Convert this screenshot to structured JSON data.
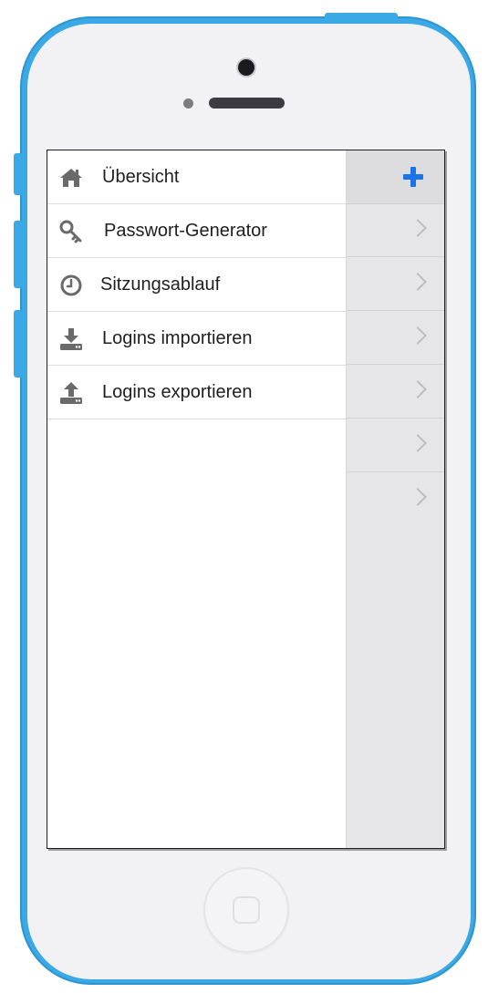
{
  "menu": {
    "items": [
      {
        "label": "Übersicht",
        "icon": "home-icon"
      },
      {
        "label": "Passwort-Generator",
        "icon": "key-icon"
      },
      {
        "label": "Sitzungsablauf",
        "icon": "clock-icon"
      },
      {
        "label": "Logins importieren",
        "icon": "download-icon"
      },
      {
        "label": "Logins exportieren",
        "icon": "upload-icon"
      }
    ]
  },
  "right_pane": {
    "header_icon": "plus-icon",
    "row_icon": "chevron-right-icon",
    "row_count": 6
  },
  "colors": {
    "device_frame": "#3aa9e6",
    "accent": "#1a73e8",
    "icon_gray": "#6a6a6a"
  }
}
